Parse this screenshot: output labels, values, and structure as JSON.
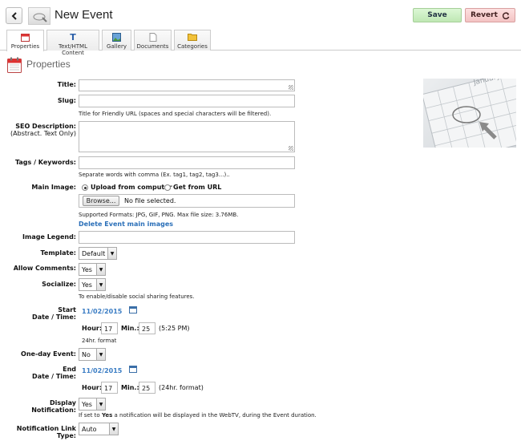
{
  "header": {
    "title": "New Event",
    "save_label": "Save",
    "revert_label": "Revert"
  },
  "tabs": [
    {
      "label": "Properties",
      "icon": "calendar-icon"
    },
    {
      "label": "Text/HTML Content",
      "icon": "text-icon"
    },
    {
      "label": "Gallery",
      "icon": "picture-icon"
    },
    {
      "label": "Documents",
      "icon": "document-icon"
    },
    {
      "label": "Categories",
      "icon": "folder-icon"
    }
  ],
  "section": {
    "title": "Properties"
  },
  "form": {
    "title_label": "Title:",
    "slug_label": "Slug:",
    "slug_hint": "Title for Friendly URL (spaces and special characters will be filtered).",
    "seo_label": "SEO Description:",
    "seo_sub": "(Abstract. Text Only)",
    "tags_label": "Tags / Keywords:",
    "tags_hint": "Separate words with comma (Ex. tag1, tag2, tag3...)..",
    "main_image_label": "Main Image:",
    "upload_option": "Upload from computer",
    "url_option": "Get from URL",
    "browse_label": "Browse...",
    "file_status": "No file selected.",
    "formats_hint": "Supported Formats: JPG, GIF, PNG. Max file size: 3.76MB.",
    "delete_images_link": "Delete Event main images",
    "image_legend_label": "Image Legend:",
    "template_label": "Template:",
    "template_value": "Default",
    "comments_label": "Allow Comments:",
    "comments_value": "Yes",
    "socialize_label": "Socialize:",
    "socialize_value": "Yes",
    "socialize_hint": "To enable/disable social sharing features.",
    "start_label_1": "Start",
    "start_label_2": "Date / Time:",
    "start_date": "11/02/2015",
    "hour_label": "Hour:",
    "min_label": "Min.:",
    "start_hour": "17",
    "start_min": "25",
    "start_time_text": "(5:25 PM)",
    "format_hint": "24hr. format",
    "oneday_label": "One-day Event:",
    "oneday_value": "No",
    "end_label_1": "End",
    "end_label_2": "Date / Time:",
    "end_date": "11/02/2015",
    "end_hour": "17",
    "end_min": "25",
    "end_time_text": "(24hr. format)",
    "notification_label": "Display Notification:",
    "notification_value": "Yes",
    "notification_hint_pre": "If set to ",
    "notification_hint_bold": "Yes",
    "notification_hint_post": " a notification will be displayed in the WebTV, during the Event duration.",
    "link_type_label": "Notification Link Type:",
    "link_type_value": "Auto"
  },
  "preview": {
    "text": "January"
  }
}
